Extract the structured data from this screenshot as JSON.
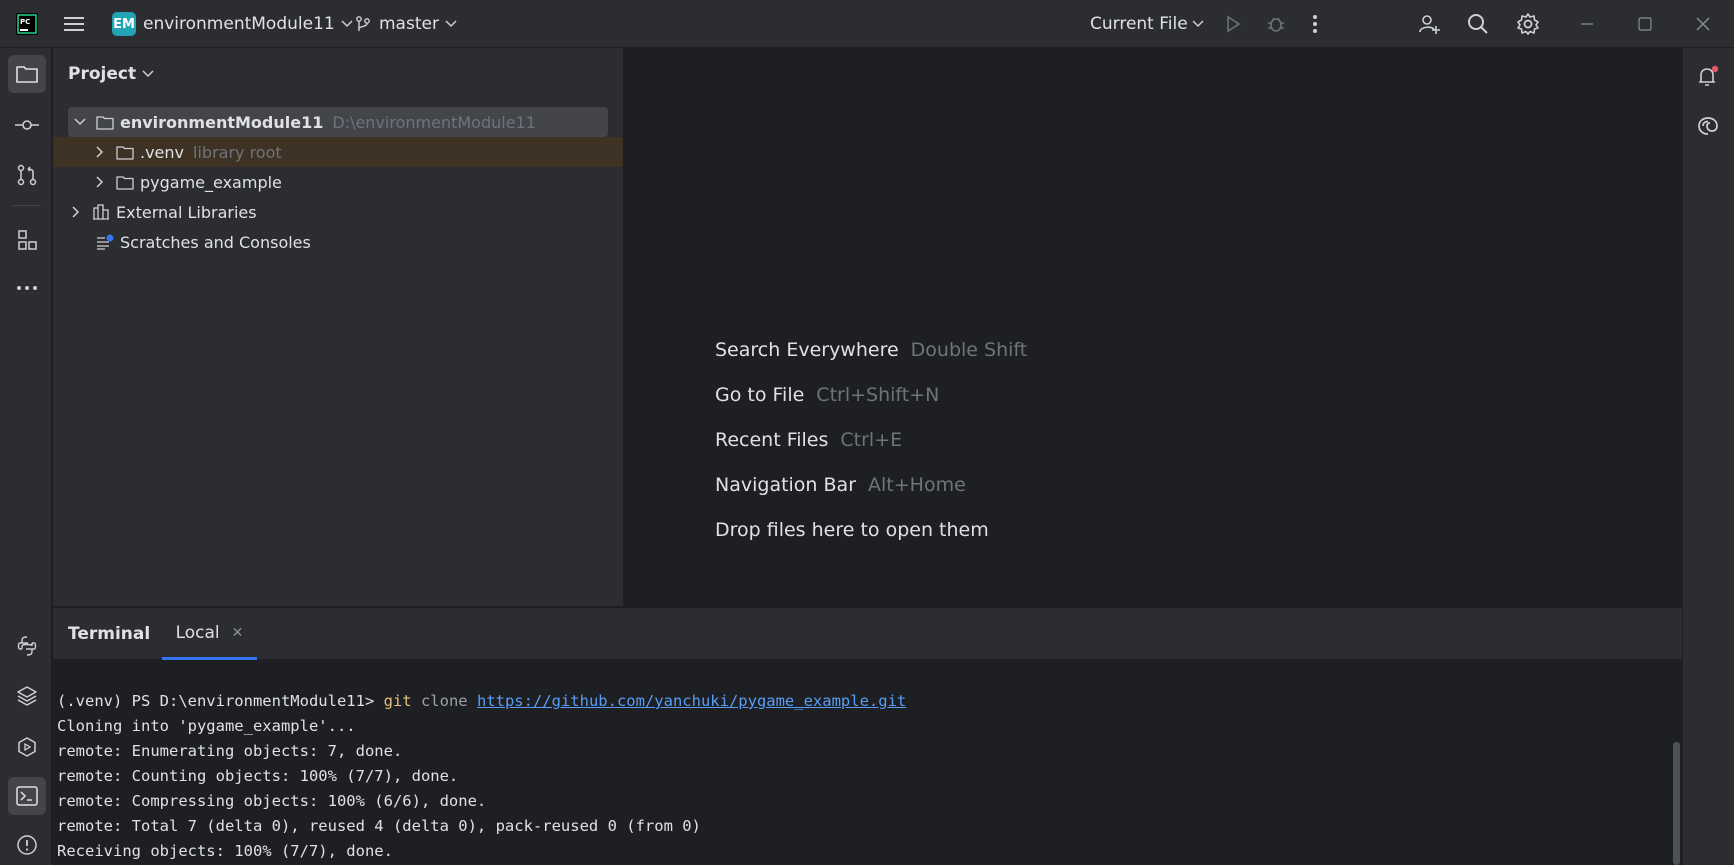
{
  "titlebar": {
    "project_badge": "EM",
    "project_name": "environmentModule11",
    "branch": "master",
    "run_config": "Current File"
  },
  "project_panel": {
    "header": "Project",
    "tree": {
      "root": {
        "name": "environmentModule11",
        "path": "D:\\environmentModule11"
      },
      "venv": {
        "name": ".venv",
        "hint": "library root"
      },
      "pygame": {
        "name": "pygame_example"
      },
      "external": {
        "name": "External Libraries"
      },
      "scratches": {
        "name": "Scratches and Consoles"
      }
    }
  },
  "editor": {
    "hints": [
      {
        "label": "Search Everywhere",
        "key": "Double Shift"
      },
      {
        "label": "Go to File",
        "key": "Ctrl+Shift+N"
      },
      {
        "label": "Recent Files",
        "key": "Ctrl+E"
      },
      {
        "label": "Navigation Bar",
        "key": "Alt+Home"
      },
      {
        "label": "Drop files here to open them",
        "key": ""
      }
    ]
  },
  "terminal": {
    "title": "Terminal",
    "tab": "Local",
    "prompt": "(.venv) PS D:\\environmentModule11> ",
    "command": "git",
    "command_arg": "clone",
    "command_url": "https://github.com/yanchuki/pygame_example.git",
    "lines": [
      "Cloning into 'pygame_example'...",
      "remote: Enumerating objects: 7, done.",
      "remote: Counting objects: 100% (7/7), done.",
      "remote: Compressing objects: 100% (6/6), done.",
      "remote: Total 7 (delta 0), reused 4 (delta 0), pack-reused 0 (from 0)",
      "Receiving objects: 100% (7/7), done."
    ]
  },
  "colors": {
    "accent": "#3574f0",
    "badge": "#21a4b6",
    "selection": "#43454a",
    "library_row": "#3d3223",
    "notification_dot": "#e55765"
  }
}
